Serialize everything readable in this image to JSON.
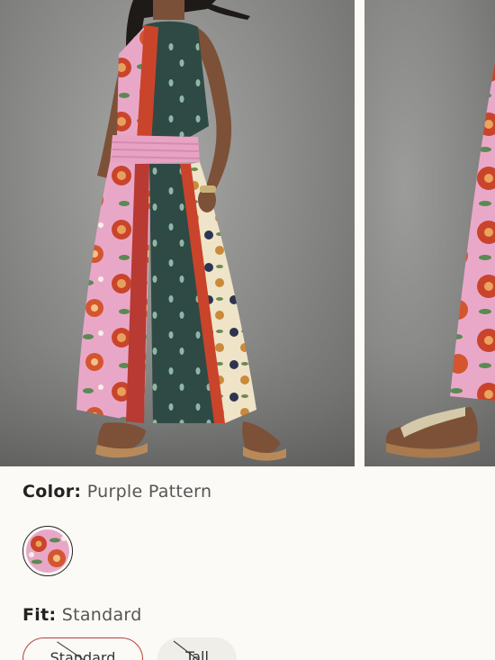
{
  "product_images": [
    {
      "alt_icon": "model-photo-front-icon"
    },
    {
      "alt_icon": "model-photo-detail-icon"
    }
  ],
  "color": {
    "label": "Color:",
    "value": "Purple Pattern",
    "swatch_icon": "floral-swatch-icon"
  },
  "fit": {
    "label": "Fit:",
    "value": "Standard",
    "options": [
      {
        "label": "Standard",
        "selected": true,
        "unavailable": true
      },
      {
        "label": "Tall",
        "selected": false,
        "unavailable": true
      }
    ]
  },
  "colors": {
    "background": "#fbfaf6",
    "selected_border": "#b8403c",
    "option_bg": "#efeee9"
  }
}
